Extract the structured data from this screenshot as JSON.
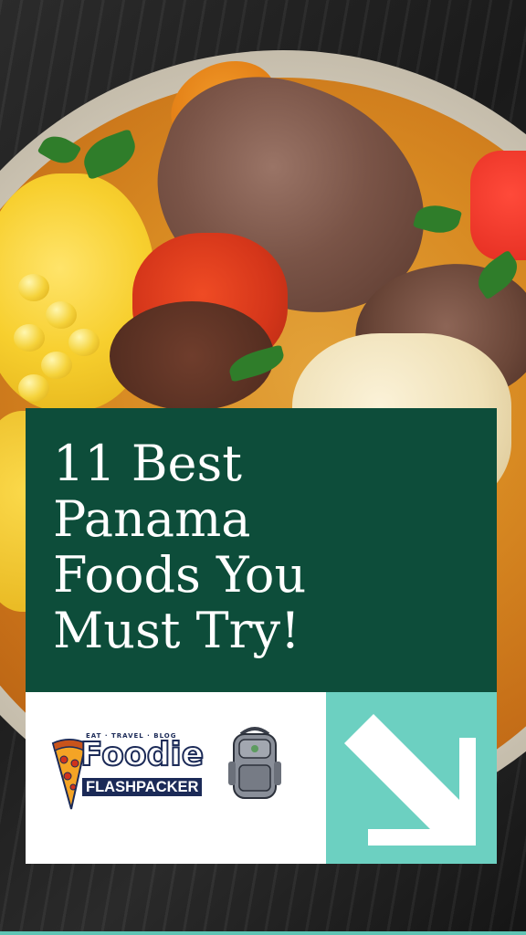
{
  "title": {
    "lines": [
      "11 Best",
      "Panama",
      "Foods You",
      "Must Try!"
    ]
  },
  "logo": {
    "tagline": "EAT · TRAVEL · BLOG",
    "name_top": "Foodie",
    "name_bottom": "FLASHPACKER"
  },
  "colors": {
    "title_bg": "#0d4d3a",
    "accent": "#6cd0c1",
    "logo_navy": "#1b2a57"
  },
  "icons": {
    "arrow": "arrow-down-right-icon",
    "pizza": "pizza-slice-icon",
    "backpack": "backpack-icon"
  }
}
